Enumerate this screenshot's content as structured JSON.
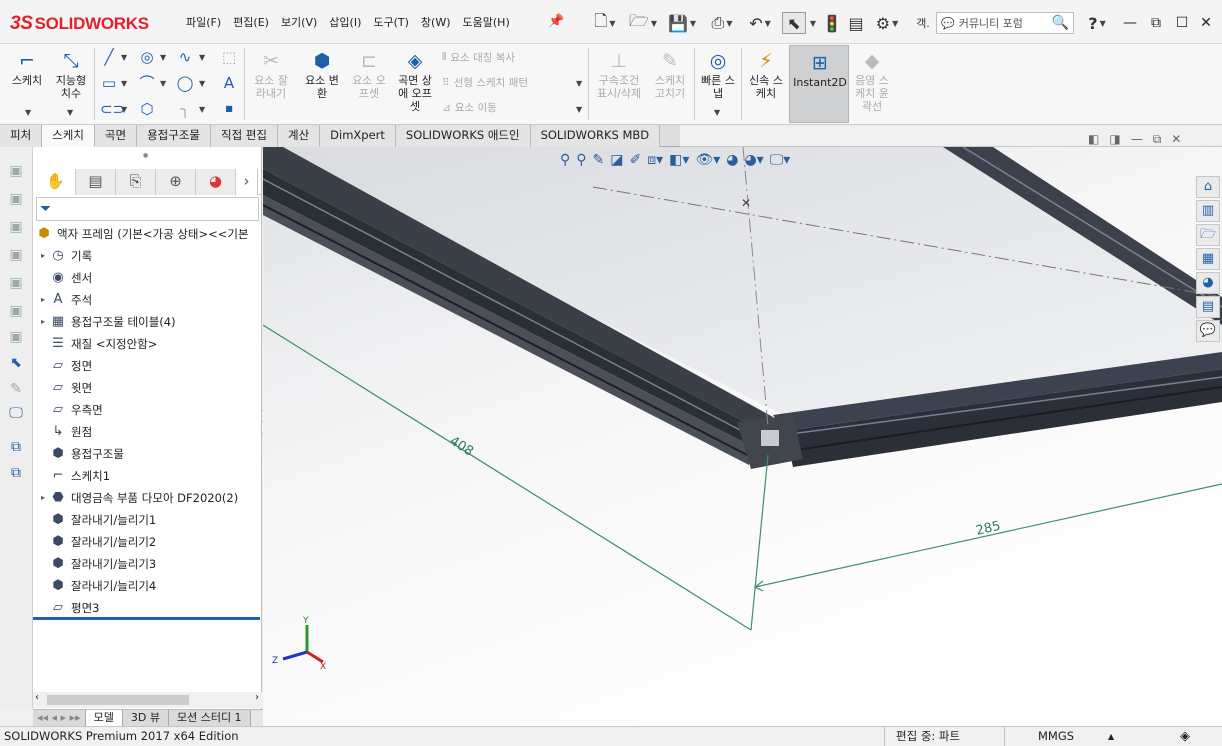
{
  "app": {
    "logo_text": "SOLIDWORKS",
    "logo_mark": "3S"
  },
  "menu": [
    "파일(F)",
    "편집(E)",
    "보기(V)",
    "삽입(I)",
    "도구(T)",
    "창(W)",
    "도움말(H)"
  ],
  "quick_access": {
    "search_prefix": "객.",
    "search_placeholder": "커뮤니티 포럼",
    "help": "?"
  },
  "toolbar": {
    "sketch": "스케치",
    "smart_dim": "지능형\n치수",
    "trim": "요소 잘\n라내기",
    "convert": "요소 변\n환",
    "offset": "요소 오\n프셋",
    "face_offset": "곡면 상\n에 오프\n셋",
    "mirror": "요소 대칭 복사",
    "linear_pattern": "선형 스케치 패턴",
    "move": "요소 이동",
    "relations": "구속조건\n표시/삭제",
    "repair": "스케치\n고치기",
    "quick_snaps": "빠른 스\n냅",
    "rapid_sketch": "신속 스\n케치",
    "instant2d": "Instant2D",
    "shaded": "음영 스\n케치 윤\n곽선"
  },
  "tabs": [
    "피처",
    "스케치",
    "곡면",
    "용접구조물",
    "직접 편집",
    "계산",
    "DimXpert",
    "SOLIDWORKS 애드인",
    "SOLIDWORKS MBD"
  ],
  "active_tab": "스케치",
  "tree": {
    "root": "액자 프레임  (기본<가공 상태><<기본",
    "items": [
      {
        "label": "기록",
        "icon": "history-icon",
        "exp": true
      },
      {
        "label": "센서",
        "icon": "sensor-icon",
        "exp": false
      },
      {
        "label": "주석",
        "icon": "annotation-icon",
        "exp": true
      },
      {
        "label": "용접구조물 테이블(4)",
        "icon": "table-icon",
        "exp": true
      },
      {
        "label": "재질 <지정안함>",
        "icon": "material-icon",
        "exp": false
      },
      {
        "label": "정면",
        "icon": "plane-icon",
        "exp": false
      },
      {
        "label": "윗면",
        "icon": "plane-icon",
        "exp": false
      },
      {
        "label": "우측면",
        "icon": "plane-icon",
        "exp": false
      },
      {
        "label": "원점",
        "icon": "origin-icon",
        "exp": false
      },
      {
        "label": "용접구조물",
        "icon": "weldment-icon",
        "exp": false
      },
      {
        "label": "스케치1",
        "icon": "sketch-icon",
        "exp": false
      },
      {
        "label": "대영금속 부품 다모아 DF2020(2)",
        "icon": "part-icon",
        "exp": true
      },
      {
        "label": "잘라내기/늘리기1",
        "icon": "trim-extend-icon",
        "exp": false
      },
      {
        "label": "잘라내기/늘리기2",
        "icon": "trim-extend-icon",
        "exp": false
      },
      {
        "label": "잘라내기/늘리기3",
        "icon": "trim-extend-icon",
        "exp": false
      },
      {
        "label": "잘라내기/늘리기4",
        "icon": "trim-extend-icon",
        "exp": false
      },
      {
        "label": "평면3",
        "icon": "plane-icon",
        "exp": false
      }
    ]
  },
  "bottom_tabs": [
    "모델",
    "3D 뷰",
    "모션 스터디 1"
  ],
  "viewport": {
    "dim_a": "408",
    "dim_b": "285",
    "axis_x": "X",
    "axis_y": "Y",
    "axis_z": "Z"
  },
  "status": {
    "edition": "SOLIDWORKS Premium 2017 x64 Edition",
    "editing": "편집 중: 파트",
    "units": "MMGS"
  }
}
